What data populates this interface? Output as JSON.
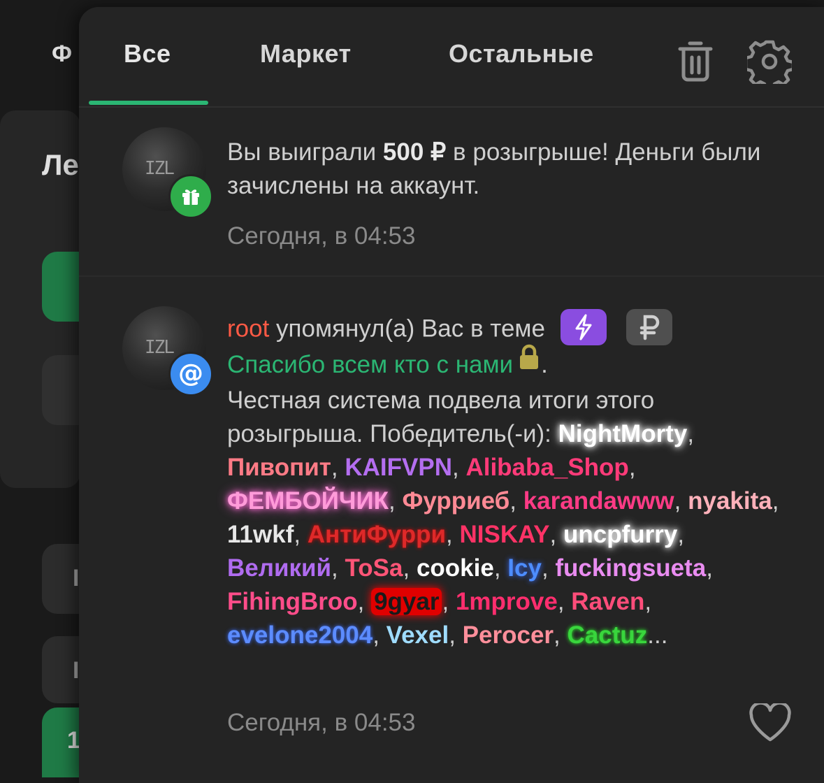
{
  "background": {
    "left_letter_1": "Ф",
    "left_letter_2": "Ле",
    "left_letter_3": "I",
    "left_letter_4": "I",
    "left_letter_5": "1"
  },
  "tabs": [
    {
      "label": "Все",
      "active": true
    },
    {
      "label": "Маркет",
      "active": false
    },
    {
      "label": "Остальные",
      "active": false
    }
  ],
  "accent_color": "#2bb673",
  "notifications": [
    {
      "text_before": "Вы выиграли ",
      "amount": "500 ₽",
      "text_after": " в розыгрыше! Деньги были зачислены на аккаунт.",
      "time": "Сегодня, в 04:53",
      "badge_icon": "gift-icon",
      "badge_color": "#2fad4b",
      "avatar_logo": "IZL"
    },
    {
      "author": "root",
      "action": " упомянул(а) Вас в теме",
      "thread_title": "Спасибо всем кто с нами",
      "period": ".",
      "body_intro": "Честная система подвела итоги этого розыгрыша. Победитель(-и): ",
      "winners": [
        {
          "name": "NightMorty",
          "color": "#ffffff",
          "effect": "glow-white"
        },
        {
          "name": "Пивопит",
          "color": "#ff7b86"
        },
        {
          "name": "KAIFVPN",
          "color": "#b46ef0"
        },
        {
          "name": "Alibaba_Shop",
          "color": "#ff3b79"
        },
        {
          "name": "ФЕМБОЙЧИК",
          "color": "#ff9bd9",
          "effect": "glow-pink"
        },
        {
          "name": "Фурриеб",
          "color": "#ff8a95"
        },
        {
          "name": "karandawww",
          "color": "#ff3b86"
        },
        {
          "name": "nyakita",
          "color": "#ffb1ba"
        },
        {
          "name": "11wkf",
          "color": "#e8e8e8"
        },
        {
          "name": "АнтиФурри",
          "color": "#ff2a2a",
          "effect": "glow-red"
        },
        {
          "name": "NISKAY",
          "color": "#ff3366"
        },
        {
          "name": "uncpfurry",
          "color": "#ffffff",
          "effect": "glow-white"
        },
        {
          "name": "Великий",
          "color": "#b06cf0"
        },
        {
          "name": "ToSa",
          "color": "#ff5577"
        },
        {
          "name": "cookie",
          "color": "#ffffff"
        },
        {
          "name": "Icy",
          "color": "#4d8dff",
          "effect": "glow-blue"
        },
        {
          "name": "fuckingsueta",
          "color": "#e98cf0"
        },
        {
          "name": "FihingBroo",
          "color": "#ff4d8a"
        },
        {
          "name": "9gyar",
          "color": "#1a1a1a",
          "effect": "red-box"
        },
        {
          "name": "1mprove",
          "color": "#ff2e6e"
        },
        {
          "name": "Raven",
          "color": "#ff4d7a"
        },
        {
          "name": "evelone2004",
          "color": "#5c8cff",
          "effect": "glow-blue-gradient"
        },
        {
          "name": "Vexel",
          "color": "#9fdcff"
        },
        {
          "name": "Perocer",
          "color": "#ff8f9b"
        },
        {
          "name": "Cactuz",
          "color": "#39d63d",
          "effect": "glow-green"
        }
      ],
      "ellipsis": "...",
      "time": "Сегодня, в 04:53",
      "badge_icon": "at-icon",
      "badge_color": "#3b8cf0",
      "avatar_logo": "IZL",
      "tag_icons": [
        "lightning-icon",
        "ruble-icon"
      ],
      "tag_colors": [
        "#8a4de0",
        "#555555"
      ],
      "lock_color": "#b8a84a"
    }
  ],
  "icons": {
    "trash": "trash-icon",
    "settings": "gear-icon",
    "like": "heart-icon"
  }
}
